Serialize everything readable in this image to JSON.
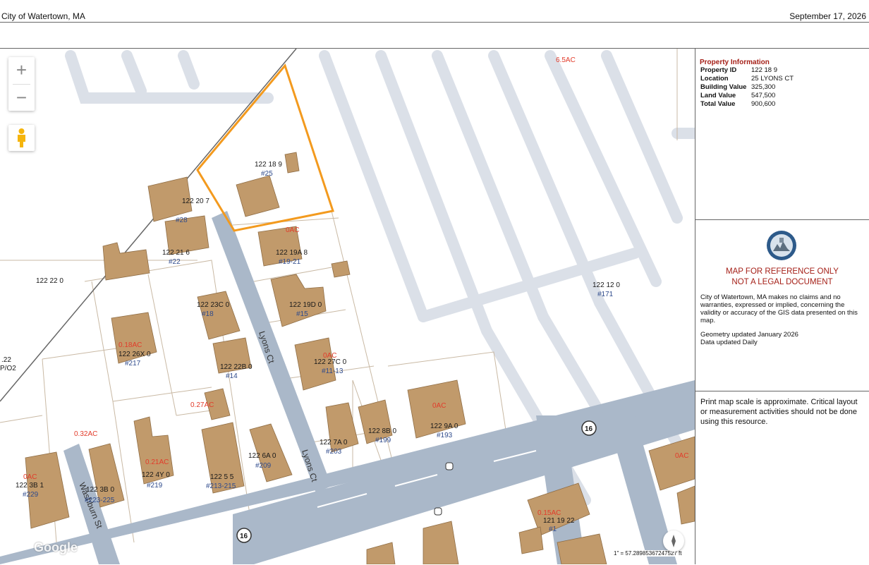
{
  "header": {
    "city": "City of Watertown, MA",
    "date": "September 17, 2026"
  },
  "map": {
    "zoom_in": "+",
    "zoom_out": "−",
    "attribution": "Google",
    "scale_text": "1\" = 57.28985367247527 ft",
    "streets": {
      "lyons_upper": "Lyons Ct",
      "lyons_lower": "Lyons Ct",
      "washburn": "Washburn St",
      "route_a": "16",
      "route_b": "16"
    },
    "parcels": [
      {
        "id": "122 18 9",
        "addr": "#25"
      },
      {
        "id": "122 20 7",
        "addr": "#28"
      },
      {
        "id": "122 21 6",
        "addr": "#22"
      },
      {
        "id": "122 19A 8",
        "addr": "#19-21"
      },
      {
        "id": "122 22 0",
        "addr": ""
      },
      {
        "id": "122 23C 0",
        "addr": "#18"
      },
      {
        "id": "122 19D 0",
        "addr": "#15"
      },
      {
        "id": "122 12 0",
        "addr": "#171"
      },
      {
        "id": "122 26X 0",
        "addr": "#217"
      },
      {
        "id": "122 22B 0",
        "addr": "#14"
      },
      {
        "id": "122 27C 0",
        "addr": "#11-13"
      },
      {
        "id": "122 7A 0",
        "addr": "#203"
      },
      {
        "id": "122 8B 0",
        "addr": "#199"
      },
      {
        "id": "122 9A 0",
        "addr": "#193"
      },
      {
        "id": "122 3B 1",
        "addr": "#229"
      },
      {
        "id": "122 3B 0",
        "addr": "#223-225"
      },
      {
        "id": "122 4Y 0",
        "addr": "#219"
      },
      {
        "id": "122 5 5",
        "addr": "#213-215"
      },
      {
        "id": "122 6A 0",
        "addr": "#209"
      },
      {
        "id": "121 19 22",
        "addr": "#1"
      }
    ],
    "areas": [
      "6.5AC",
      "0.18AC",
      "0.27AC",
      "0.32AC",
      "0.21AC",
      "0.15AC",
      "0AC",
      "0AC",
      "0AC",
      "0AC",
      "0AC"
    ],
    "edge_labels": {
      "left_a": ".22",
      "left_b": "P/O2"
    }
  },
  "property": {
    "title": "Property Information",
    "rows": [
      {
        "label": "Property ID",
        "value": "122 18 9"
      },
      {
        "label": "Location",
        "value": "25 LYONS CT"
      },
      {
        "label": "Building Value",
        "value": "325,300"
      },
      {
        "label": "Land Value",
        "value": "547,500"
      },
      {
        "label": "Total Value",
        "value": "900,600"
      }
    ]
  },
  "notice": {
    "line1": "MAP FOR REFERENCE ONLY",
    "line2": "NOT A LEGAL DOCUMENT",
    "disclaimer": "City of Watertown, MA makes no claims and no warranties, expressed or implied, concerning the validity or accuracy of the GIS data presented on this map.",
    "geometry": "Geometry updated January 2026",
    "data": "Data updated Daily"
  },
  "scale_notice": "Print map scale is approximate. Critical layout or measurement activities should not be done using this resource.",
  "colors": {
    "highlight": "#f39a1e",
    "building": "#c19a6b",
    "road": "#aab8c9",
    "accent": "#a52018"
  }
}
